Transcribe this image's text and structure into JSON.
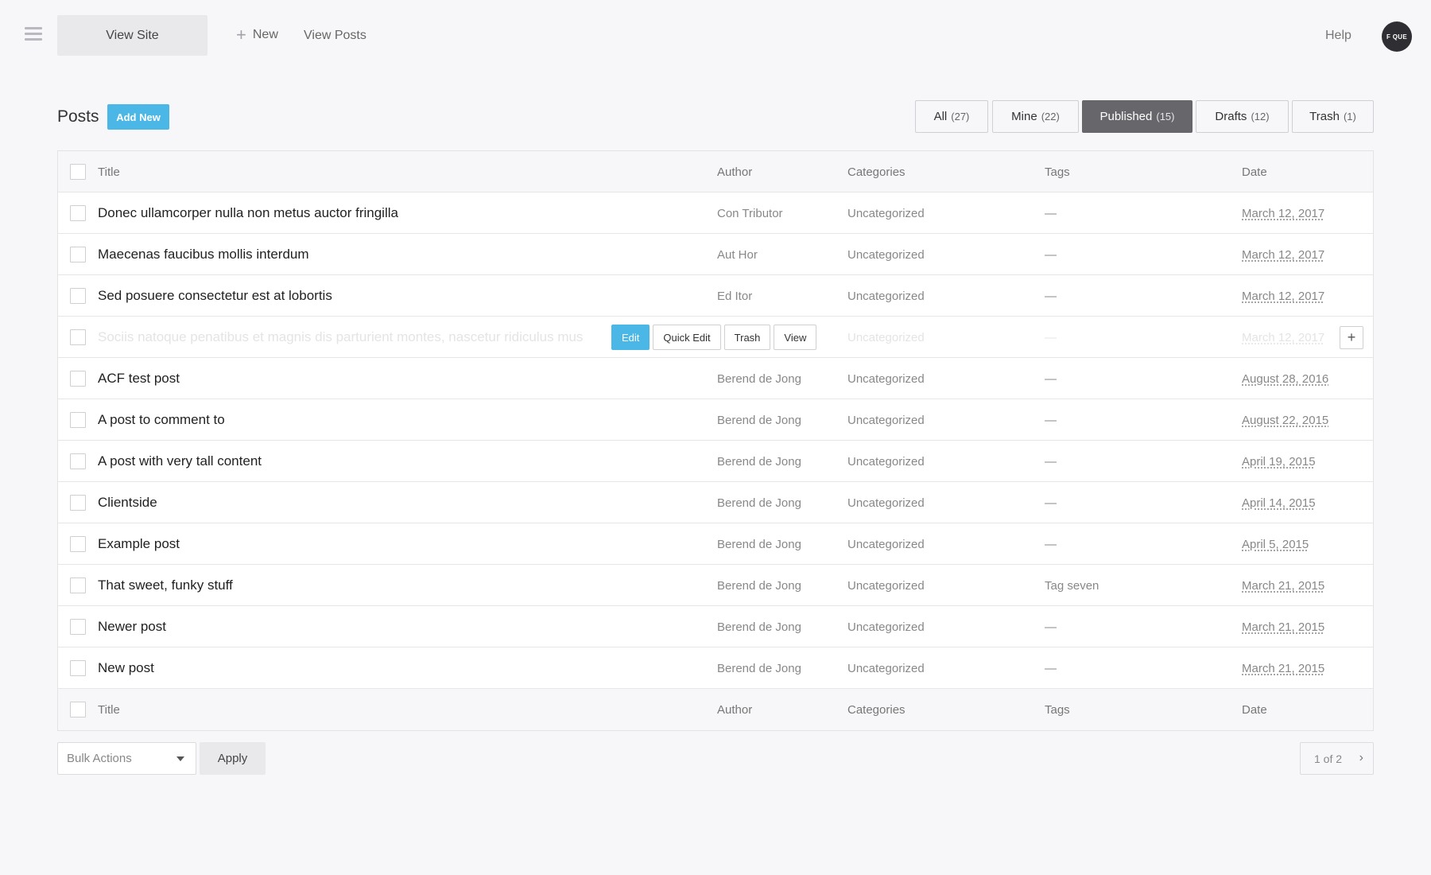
{
  "topbar": {
    "view_site": "View Site",
    "new": "New",
    "view_posts": "View Posts",
    "help": "Help",
    "avatar_initials": "F QUE"
  },
  "page": {
    "title": "Posts",
    "add_new": "Add New"
  },
  "filters": [
    {
      "label": "All",
      "count": "(27)",
      "active": false
    },
    {
      "label": "Mine",
      "count": "(22)",
      "active": false
    },
    {
      "label": "Published",
      "count": "(15)",
      "active": true
    },
    {
      "label": "Drafts",
      "count": "(12)",
      "active": false
    },
    {
      "label": "Trash",
      "count": "(1)",
      "active": false
    }
  ],
  "table": {
    "columns": {
      "title": "Title",
      "author": "Author",
      "categories": "Categories",
      "tags": "Tags",
      "date": "Date"
    },
    "rows": [
      {
        "title": "Donec ullamcorper nulla non metus auctor fringilla",
        "author": "Con Tributor",
        "categories": "Uncategorized",
        "tags": "—",
        "date": "March 12, 2017"
      },
      {
        "title": "Maecenas faucibus mollis interdum",
        "author": "Aut Hor",
        "categories": "Uncategorized",
        "tags": "—",
        "date": "March 12, 2017"
      },
      {
        "title": "Sed posuere consectetur est at lobortis",
        "author": "Ed Itor",
        "categories": "Uncategorized",
        "tags": "—",
        "date": "March 12, 2017"
      },
      {
        "title": "Sociis natoque penatibus et magnis dis parturient montes, nascetur ridiculus mus",
        "author": "",
        "categories": "Uncategorized",
        "tags": "—",
        "date": "March 12, 2017",
        "hover": true
      },
      {
        "title": "ACF test post",
        "author": "Berend de Jong",
        "categories": "Uncategorized",
        "tags": "—",
        "date": "August 28, 2016"
      },
      {
        "title": "A post to comment to",
        "author": "Berend de Jong",
        "categories": "Uncategorized",
        "tags": "—",
        "date": "August 22, 2015"
      },
      {
        "title": "A post with very tall content",
        "author": "Berend de Jong",
        "categories": "Uncategorized",
        "tags": "—",
        "date": "April 19, 2015"
      },
      {
        "title": "Clientside",
        "author": "Berend de Jong",
        "categories": "Uncategorized",
        "tags": "—",
        "date": "April 14, 2015"
      },
      {
        "title": "Example post",
        "author": "Berend de Jong",
        "categories": "Uncategorized",
        "tags": "—",
        "date": "April 5, 2015"
      },
      {
        "title": "That sweet, funky stuff",
        "author": "Berend de Jong",
        "categories": "Uncategorized",
        "tags": "Tag seven",
        "date": "March 21, 2015"
      },
      {
        "title": "Newer post",
        "author": "Berend de Jong",
        "categories": "Uncategorized",
        "tags": "—",
        "date": "March 21, 2015"
      },
      {
        "title": "New post",
        "author": "Berend de Jong",
        "categories": "Uncategorized",
        "tags": "—",
        "date": "March 21, 2015"
      }
    ],
    "row_actions": {
      "edit": "Edit",
      "quick_edit": "Quick Edit",
      "trash": "Trash",
      "view": "View",
      "expand": "+"
    }
  },
  "footer": {
    "bulk_actions": "Bulk Actions",
    "apply": "Apply",
    "pagination": "1 of 2",
    "next": "›"
  },
  "colors": {
    "accent": "#4ab7e6",
    "active_filter": "#66666b",
    "background": "#f7f7f9"
  },
  "icons": {
    "menu": "hamburger-menu-icon",
    "new": "plus-icon",
    "bulk_caret": "caret-down-icon",
    "next_page": "chevron-right-icon"
  }
}
